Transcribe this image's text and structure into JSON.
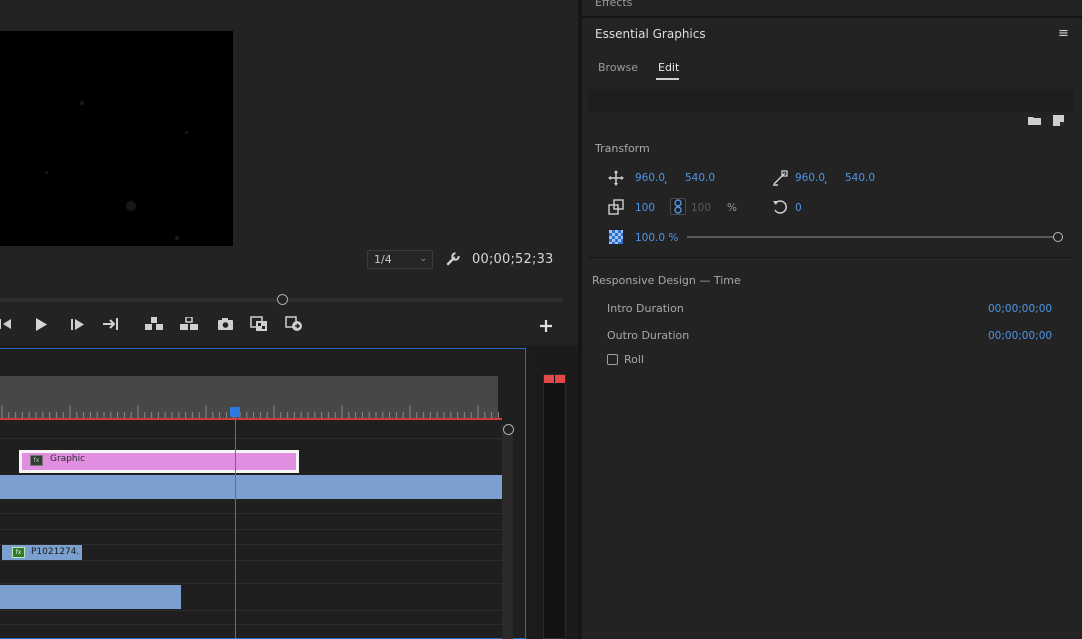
{
  "monitor": {
    "resolution": "1/4",
    "timecode": "00;00;52;33"
  },
  "transport": {
    "buttons": [
      "step-back-icon",
      "play-icon",
      "step-forward-icon",
      "go-to-out-icon",
      "lift-icon",
      "extract-icon",
      "export-frame-icon",
      "compare-view-icon",
      "proxy-toggle-icon",
      "add-button-icon"
    ]
  },
  "timeline": {
    "clips": {
      "graphic": "Graphic",
      "video": "P1021274."
    },
    "colors": {
      "graphic_clip": "#e28ee0",
      "video_clip": "#7ba0cf",
      "playhead": "#2e7ae5",
      "work_area": "#d23c3c"
    }
  },
  "panel": {
    "top_tab": "Effects",
    "title": "Essential Graphics",
    "tabs": [
      "Browse",
      "Edit"
    ],
    "active_tab": "Edit",
    "transform": {
      "title": "Transform",
      "position_x": "960.0",
      "position_y": "540.0",
      "anchor_x": "960.0",
      "anchor_y": "540.0",
      "scale": "100",
      "scale_linked": "100",
      "percent": "%",
      "rotation": "0",
      "opacity": "100.0 %"
    },
    "responsive": {
      "title": "Responsive Design — Time",
      "intro_label": "Intro Duration",
      "intro_value": "00;00;00;00",
      "outro_label": "Outro Duration",
      "outro_value": "00;00;00;00",
      "roll_label": "Roll"
    }
  }
}
